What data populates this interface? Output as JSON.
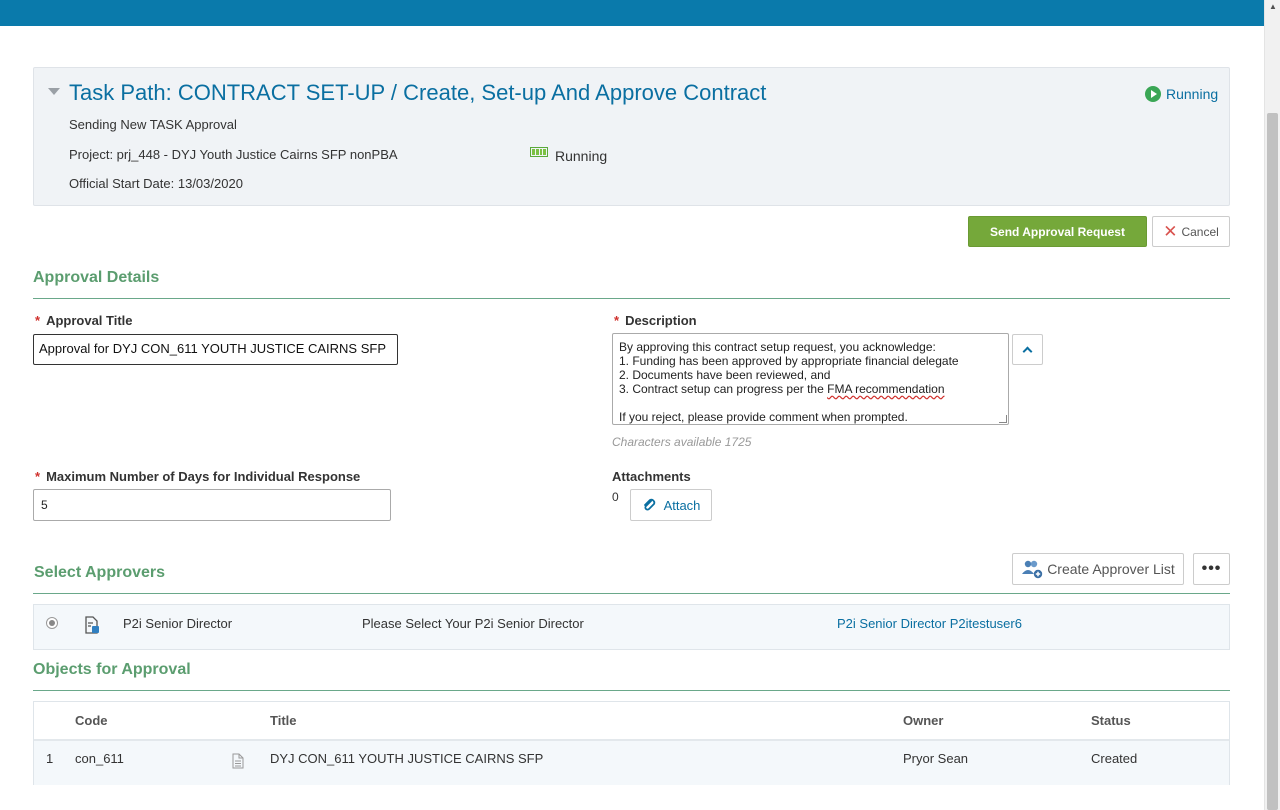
{
  "header": {
    "task_path": "Task Path: CONTRACT SET-UP / Create, Set-up And Approve Contract",
    "subtitle": "Sending New TASK Approval",
    "project": "Project: prj_448 - DYJ Youth Justice Cairns SFP nonPBA",
    "start_date": "Official Start Date: 13/03/2020",
    "status_top": "Running",
    "status_mid": "Running"
  },
  "actions": {
    "send_label": "Send Approval Request",
    "cancel_label": "Cancel"
  },
  "approval_details": {
    "section_title": "Approval Details",
    "title_label": "Approval Title",
    "title_value": "Approval for DYJ CON_611 YOUTH JUSTICE CAIRNS SFP",
    "description_label": "Description",
    "description_lines": [
      "By approving this contract setup request, you acknowledge:",
      "1. Funding has been approved by appropriate financial delegate",
      "2. Documents have been reviewed, and",
      "3. Contract setup can progress per the ",
      "FMA recommendation",
      "If you reject, please provide comment when prompted."
    ],
    "chars_available": "Characters available 1725",
    "days_label": "Maximum Number of Days for Individual Response",
    "days_value": "5",
    "attachments_label": "Attachments",
    "attachments_count": "0",
    "attach_label": "Attach"
  },
  "approvers": {
    "section_title": "Select Approvers",
    "create_list_label": "Create Approver List",
    "more_label": "•••",
    "rows": [
      {
        "role": "P2i Senior Director",
        "instruction": "Please Select Your P2i Senior Director",
        "assignee": "P2i Senior Director P2itestuser6"
      }
    ]
  },
  "objects": {
    "section_title": "Objects for Approval",
    "columns": {
      "code": "Code",
      "title": "Title",
      "owner": "Owner",
      "status": "Status"
    },
    "rows": [
      {
        "index": "1",
        "code": "con_611",
        "title": "DYJ CON_611 YOUTH JUSTICE CAIRNS SFP",
        "owner": "Pryor Sean",
        "status": "Created"
      }
    ]
  },
  "colors": {
    "topbar": "#0a7aab",
    "accent_link": "#0a6fa1",
    "send_button": "#75a83a",
    "section_title": "#5b9d6f",
    "required": "#d0312d"
  }
}
